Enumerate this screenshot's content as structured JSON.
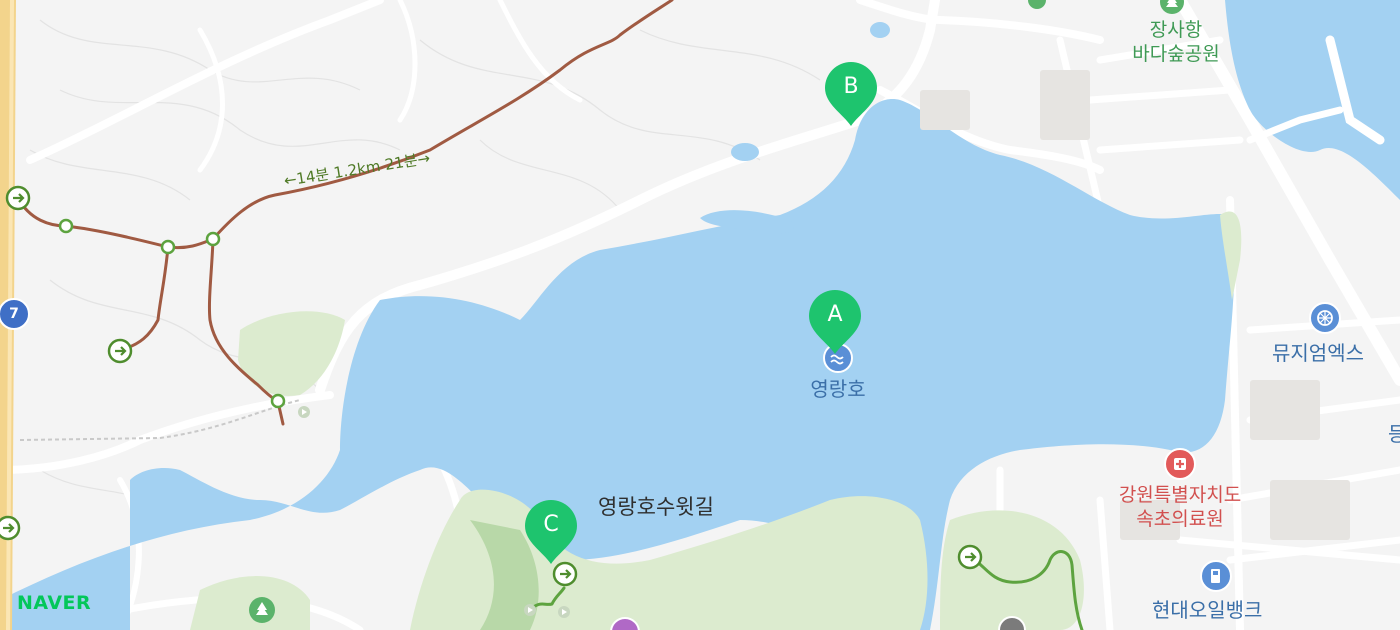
{
  "labels": {
    "park_line1": "장사항",
    "park_line2": "바다숲공원",
    "lake": "영랑호",
    "trail": "영랑호수윗길",
    "museum": "뮤지엄엑스",
    "hospital_line1": "강원특별자치도",
    "hospital_line2": "속초의료원",
    "gas_station": "현대오일뱅크",
    "route_segment": "←14분 1.2km 21분→",
    "road_number": "7",
    "edge_fragment": "등"
  },
  "markers": [
    {
      "letter": "A",
      "color": "#1ec46e"
    },
    {
      "letter": "B",
      "color": "#1ec46e"
    },
    {
      "letter": "C",
      "color": "#1ec46e"
    }
  ],
  "brand": {
    "logo_text": "NAVER",
    "color": "#03c75a"
  },
  "colors": {
    "water": "#a3d1f2",
    "land": "#f4f4f4",
    "park": "#dcebcf",
    "route_brown": "#a05a42",
    "trail_green": "#5da33f",
    "highway": "#f3d48c"
  }
}
